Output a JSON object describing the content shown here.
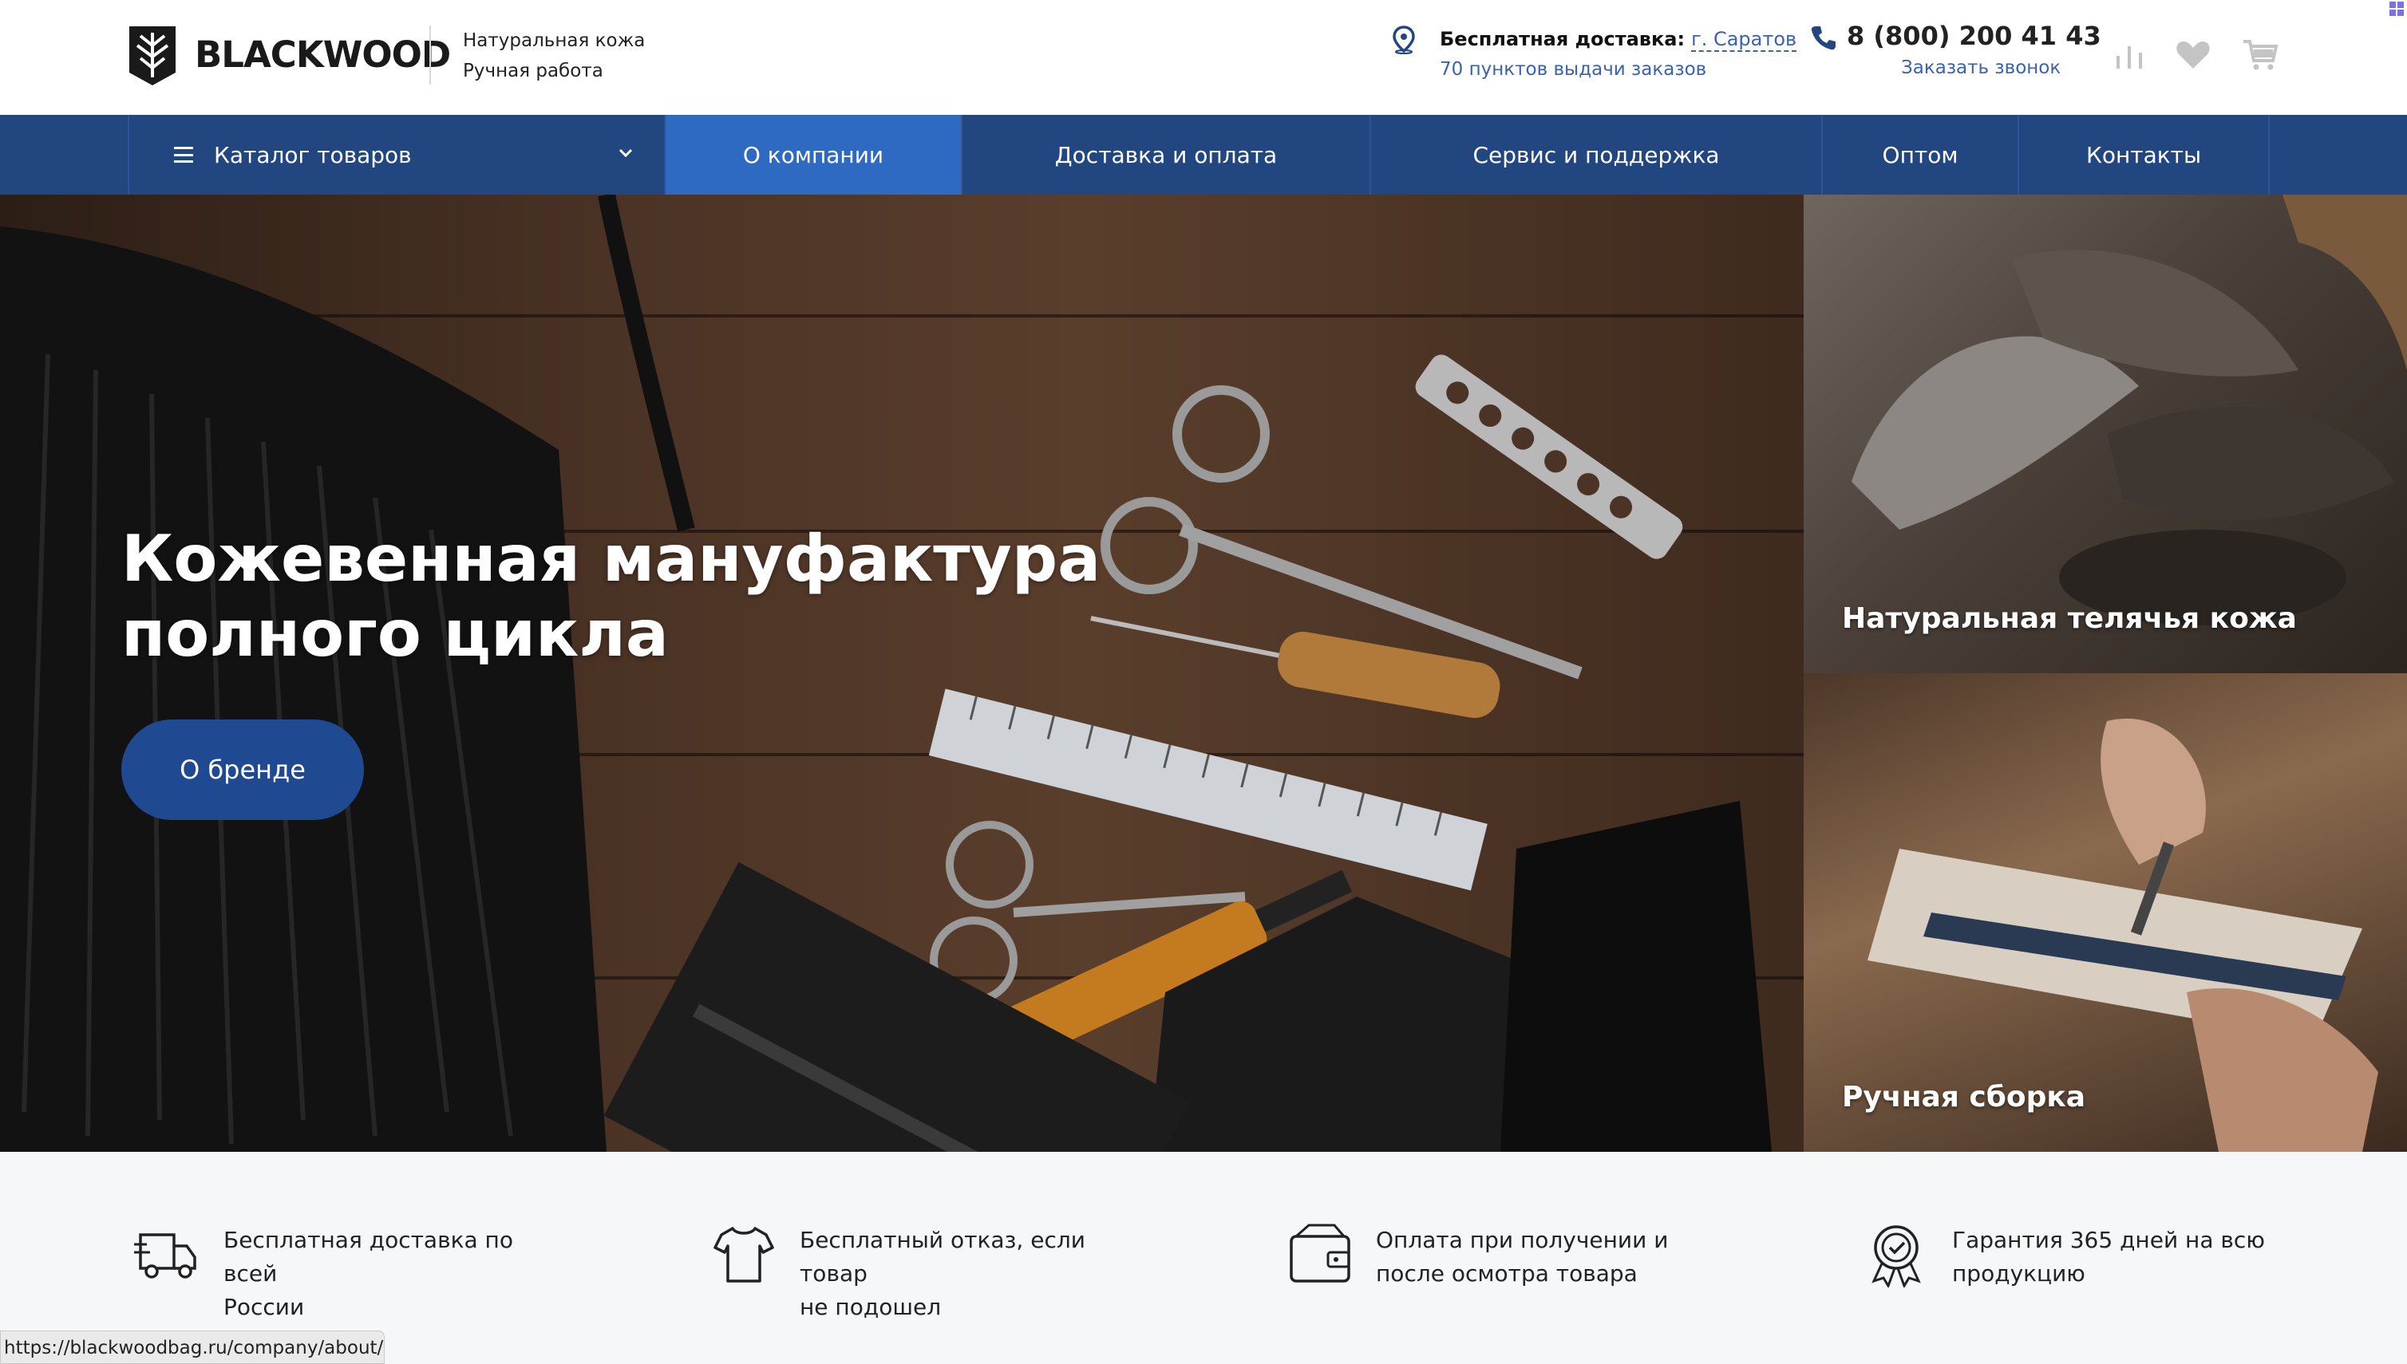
{
  "header": {
    "logo_text": "BLACKWOOD",
    "tagline": [
      "Натуральная кожа",
      "Ручная работа"
    ],
    "delivery_label": "Бесплатная доставка:",
    "delivery_city": "г. Саратов",
    "delivery_points": "70 пунктов выдачи заказов",
    "phone": "8 (800) 200 41 43",
    "callback": "Заказать звонок"
  },
  "nav": {
    "catalog": "Каталог товаров",
    "items": [
      "О компании",
      "Доставка и оплата",
      "Сервис и поддержка",
      "Оптом",
      "Контакты"
    ],
    "active_index": 0
  },
  "hero": {
    "title_line1": "Кожевенная мануфактура",
    "title_line2": "полного цикла",
    "button": "О бренде"
  },
  "side_panels": [
    "Натуральная телячья кожа",
    "Ручная сборка"
  ],
  "features": [
    {
      "icon": "delivery-truck-icon",
      "line1": "Бесплатная доставка по всей",
      "line2": "России"
    },
    {
      "icon": "tshirt-icon",
      "line1": "Бесплатный отказ, если товар",
      "line2": "не подошел"
    },
    {
      "icon": "wallet-icon",
      "line1": "Оплата при получении и",
      "line2": "после осмотра товара"
    },
    {
      "icon": "guarantee-badge-icon",
      "line1": "Гарантия 365 дней на всю",
      "line2": "продукцию"
    }
  ],
  "status_url": "https://blackwoodbag.ru/company/about/",
  "colors": {
    "nav_bg": "#22467f",
    "nav_active": "#2e6ac1",
    "link": "#3a62ad",
    "button": "#1f4a91"
  }
}
